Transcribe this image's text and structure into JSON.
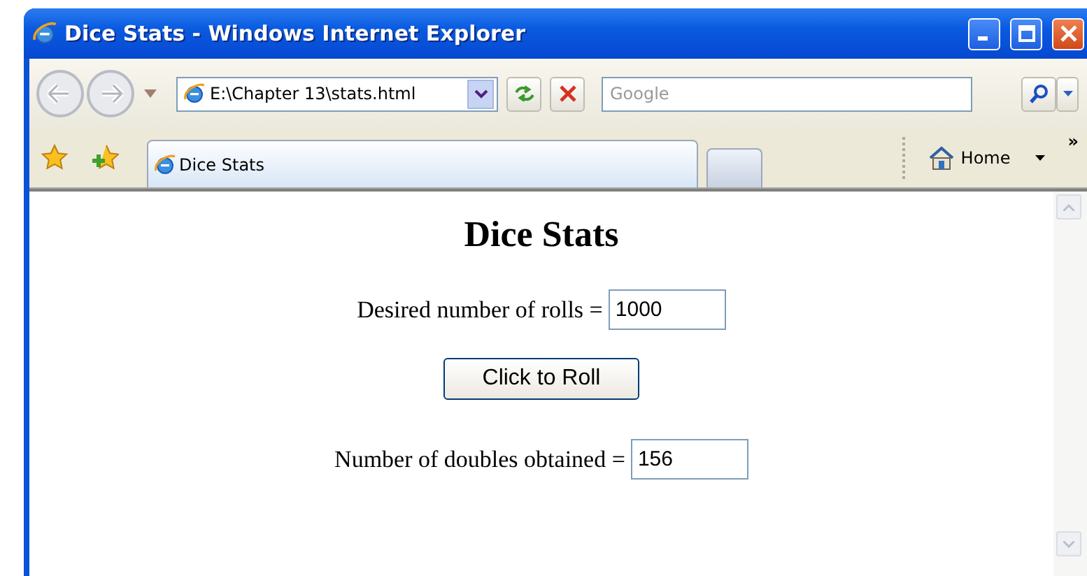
{
  "window": {
    "title": "Dice Stats - Windows Internet Explorer"
  },
  "address_bar": {
    "value": "E:\\Chapter 13\\stats.html"
  },
  "search": {
    "placeholder": "Google"
  },
  "tabs": [
    {
      "label": "Dice Stats",
      "selected": true
    }
  ],
  "command_bar": {
    "home_label": "Home",
    "overflow": "»"
  },
  "page": {
    "heading": "Dice Stats",
    "rolls": {
      "label": "Desired number of rolls =",
      "value": "1000"
    },
    "button": "Click to Roll",
    "result": {
      "label": "Number of doubles obtained =",
      "value": "156"
    }
  }
}
